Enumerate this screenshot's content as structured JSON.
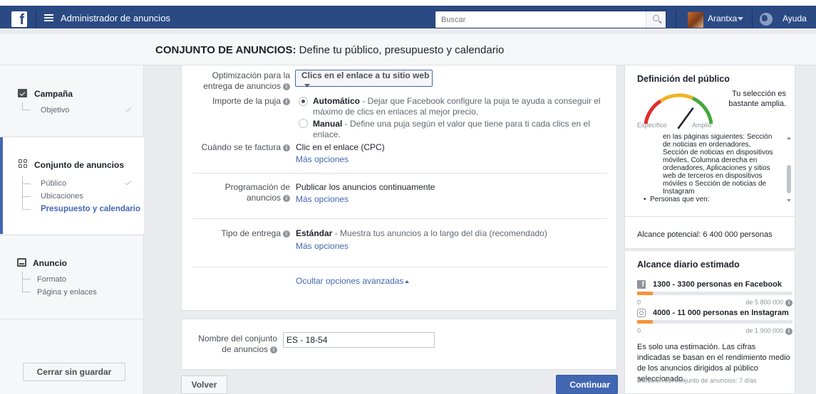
{
  "topbar": {
    "logo": "f",
    "app_title": "Administrador de anuncios",
    "search_placeholder": "Buscar",
    "user_name": "Arantxa",
    "help": "Ayuda"
  },
  "header": {
    "title_bold": "CONJUNTO DE ANUNCIOS:",
    "title_rest": " Define tu público, presupuesto y calendario"
  },
  "leftnav": {
    "campaign": {
      "label": "Campaña",
      "items": [
        {
          "label": "Objetivo",
          "done": true
        }
      ]
    },
    "adset": {
      "label": "Conjunto de anuncios",
      "items": [
        {
          "label": "Público",
          "done": true
        },
        {
          "label": "Ubicaciones",
          "done": false
        },
        {
          "label": "Presupuesto y calendario",
          "current": true
        }
      ]
    },
    "ad": {
      "label": "Anuncio",
      "items": [
        {
          "label": "Formato"
        },
        {
          "label": "Página y enlaces"
        }
      ]
    },
    "close_button": "Cerrar sin guardar"
  },
  "form": {
    "optimization": {
      "label_line1": "Optimización para la",
      "label_line2": "entrega de anuncios",
      "value": "Clics en el enlace a tu sitio web"
    },
    "bid": {
      "label": "Importe de la puja",
      "auto_title": "Automático",
      "auto_desc_line1": " - Dejar que Facebook configure la puja te ayuda a conseguir el",
      "auto_desc_line2": "máximo de clics en enlaces al mejor precio.",
      "manual_title": "Manual",
      "manual_desc": " - Define una puja según el valor que tiene para ti cada clics en el enlace.",
      "selected": "auto"
    },
    "billing": {
      "label": "Cuándo se te factura",
      "value": "Clic en el enlace (CPC)",
      "more": "Más opciones"
    },
    "schedule": {
      "label_line1": "Programación de",
      "label_line2": "anuncios",
      "value": "Publicar los anuncios continuamente",
      "more": "Más opciones"
    },
    "delivery": {
      "label": "Tipo de entrega",
      "value_bold": "Estándar",
      "value_rest": " - Muestra tus anuncios a lo largo del día (recomendado)",
      "more": "Más opciones"
    },
    "hide_advanced": "Ocultar opciones avanzadas"
  },
  "name_section": {
    "label_line1": "Nombre del conjunto",
    "label_line2": "de anuncios",
    "value": "ES - 18-54"
  },
  "footer": {
    "back": "Volver",
    "continue": "Continuar"
  },
  "audience": {
    "title": "Definición del público",
    "gauge_note": "Tu selección es bastante amplia.",
    "gauge_left": "Específico",
    "gauge_right": "Amplio",
    "gauge_level": 0.7,
    "details_lines": [
      "en las páginas siguientes: Sección",
      "de noticias en ordenadores,",
      "Sección de noticias en dispositivos",
      "móviles, Columna derecha en",
      "ordenadores, Aplicaciones y sitios",
      "web de terceros en dispositivos",
      "móviles o Sección de noticias de",
      "Instagram"
    ],
    "people_line": "Personas que ven:",
    "potential_reach": "Alcance potencial: 6 400 000 personas"
  },
  "daily_reach": {
    "title": "Alcance diario estimado",
    "facebook": {
      "label": "1300 - 3300 personas en Facebook",
      "min": "0",
      "max": "de 5 800 000",
      "fill": 0.1
    },
    "instagram": {
      "label": "4000 - 11 000 personas en Instagram",
      "min": "0",
      "max": "de 1 900 000",
      "fill": 0.1
    },
    "note": "Es solo una estimación. Las cifras indicadas se basan en el rendimiento medio de los anuncios dirigidos al público seleccionado.",
    "duration": "Duración del conjunto de anuncios: 7 días"
  },
  "colors": {
    "accent": "#4267b2",
    "topbar": "#2b4a84",
    "bar_fill": "#f7923b"
  }
}
